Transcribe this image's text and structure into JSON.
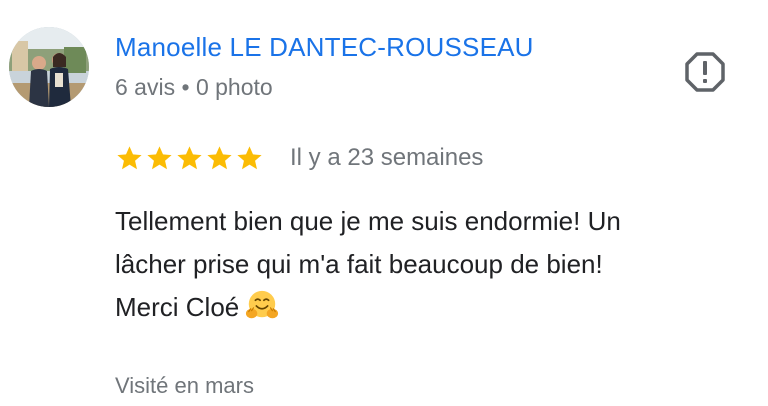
{
  "reviewer": {
    "name": "Manoelle LE DANTEC-ROUSSEAU",
    "reviews_count": "6 avis",
    "separator": "•",
    "photos_count": "0 photo"
  },
  "review": {
    "rating": 5,
    "max_rating": 5,
    "date": "Il y a 23 semaines",
    "text_lines": [
      "Tellement bien que je me suis endormie! Un",
      "lâcher prise qui m'a fait beaucoup de bien!",
      "Merci Cloé"
    ],
    "emoji": "smiling-face-with-open-hands-emoji",
    "visit": "Visité en mars"
  },
  "icons": {
    "report": "report-flag-icon",
    "star": "star-icon"
  },
  "colors": {
    "name": "#1a73e8",
    "star": "#fbbc04",
    "meta": "#70757a",
    "text": "#202124",
    "icon": "#5f6368"
  }
}
